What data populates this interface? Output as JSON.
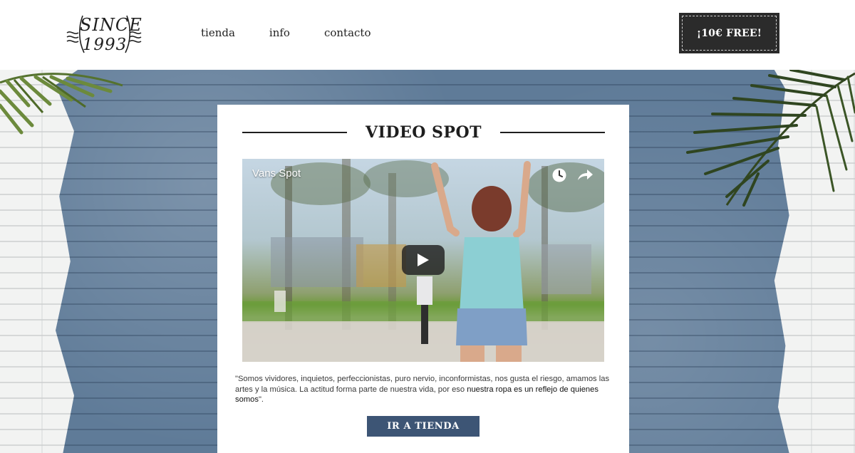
{
  "header": {
    "logo_top": "SINCE",
    "logo_bottom": "1993",
    "nav": [
      {
        "label": "tienda"
      },
      {
        "label": "info"
      },
      {
        "label": "contacto"
      }
    ],
    "promo_label": "¡10€ FREE!"
  },
  "card": {
    "title": "VIDEO SPOT",
    "video": {
      "title": "Vans Spot",
      "icons": [
        "clock-icon",
        "share-icon",
        "play-icon"
      ]
    },
    "quote": {
      "text": "\"Somos vividores, inquietos, perfeccionistas, puro nervio, inconformistas, nos gusta el riesgo, amamos las artes y la música. La actitud forma parte de nuestra vida, por eso ",
      "emphasis": "nuestra ropa es un reflejo de quienes somos",
      "end": "\"."
    },
    "cta_label": "IR A TIENDA"
  },
  "colors": {
    "promo_bg": "#2b2b2b",
    "cta_bg": "#3d5575",
    "paint_blue": "#5f7b98"
  }
}
